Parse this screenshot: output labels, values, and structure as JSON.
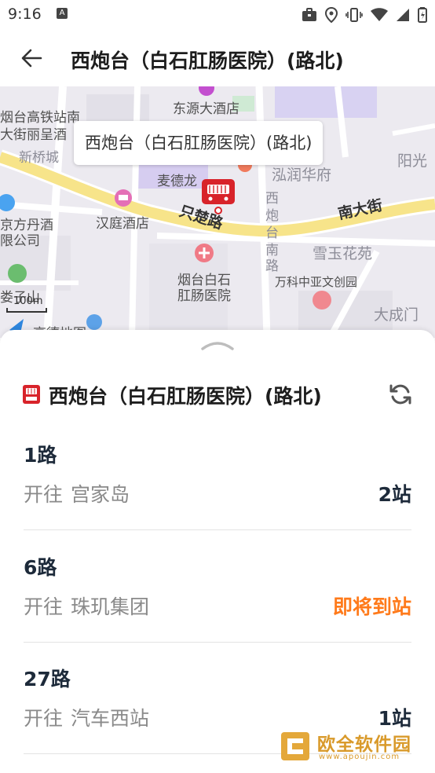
{
  "status_bar": {
    "time": "9:16",
    "notification_letter": "A"
  },
  "header": {
    "title": "西炮台（白石肛肠医院）(路北)"
  },
  "map": {
    "callout": "西炮台（白石肛肠医院）(路北)",
    "scale": "100m",
    "labels": {
      "dongyuan": "东源大酒店",
      "yantai_station_1": "烟台高铁站南",
      "yantai_station_2": "大街丽呈酒",
      "xinqiao": "新桥城",
      "maidelong": "麦德龙",
      "hongrun": "泓润华府",
      "yangguang": "阳光",
      "hanting": "汉庭酒店",
      "zhichu_road": "只楚路",
      "nan_dajie": "南大街",
      "xipaotai_1": "西",
      "xipaotai_2": "炮",
      "xipaotai_3": "台",
      "xipaotai_4": "南",
      "xipaotai_5": "路",
      "xueyu": "雪玉花苑",
      "yantai_hosp_1": "烟台白石",
      "yantai_hosp_2": "肛肠医院",
      "wanke": "万科中亚文创园",
      "dacheng": "大成门",
      "jingfangdan_1": "京方丹酒",
      "jingfangdan_2": "限公司",
      "louzishan": "娄子山",
      "gaode": "高德地图"
    }
  },
  "sheet": {
    "stop_name": "西炮台（白石肛肠医院）(路北)",
    "direction_prefix": "开往",
    "routes": [
      {
        "name": "1路",
        "destination": "宫家岛",
        "eta": "2站",
        "arriving": false
      },
      {
        "name": "6路",
        "destination": "珠玑集团",
        "eta": "即将到站",
        "arriving": true
      },
      {
        "name": "27路",
        "destination": "汽车西站",
        "eta": "1站",
        "arriving": false
      }
    ]
  },
  "watermark": {
    "title": "欧全软件园",
    "url": "www.apoujin.com"
  },
  "colors": {
    "arriving": "#ff7a1a",
    "stop_icon": "#d8232a",
    "route_text": "#1d2a3a"
  }
}
